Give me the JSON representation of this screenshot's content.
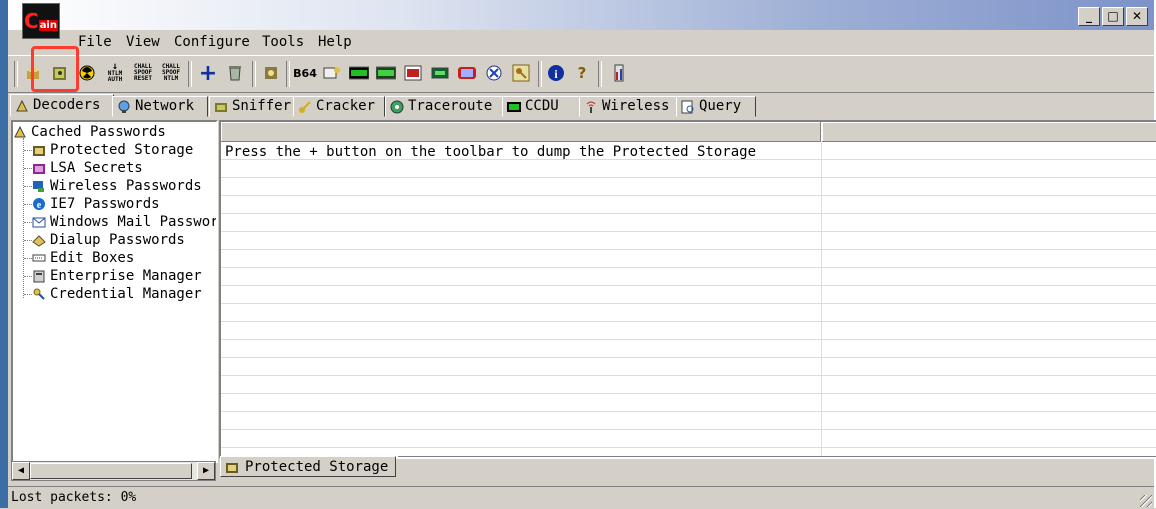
{
  "app": {
    "logo_text_c": "C",
    "logo_text_ain": "ain"
  },
  "window_buttons": {
    "minimize": "_",
    "maximize": "□",
    "close": "✕"
  },
  "menu": [
    {
      "label": "File"
    },
    {
      "label": "View"
    },
    {
      "label": "Configure"
    },
    {
      "label": "Tools"
    },
    {
      "label": "Help"
    }
  ],
  "toolbar": {
    "ntlm_auth": "NTLM AUTH",
    "chall_spoof_reset": "CHALL SPOOF RESET",
    "chall_spoof_ntlm": "CHALL SPOOF NTLM",
    "b64": "B64",
    "highlighted_button": "protected-storage-tool"
  },
  "tabs": [
    {
      "label": "Decoders",
      "active": true
    },
    {
      "label": "Network"
    },
    {
      "label": "Sniffer"
    },
    {
      "label": "Cracker"
    },
    {
      "label": "Traceroute"
    },
    {
      "label": "CCDU"
    },
    {
      "label": "Wireless"
    },
    {
      "label": "Query"
    }
  ],
  "tree": {
    "root": "Cached Passwords",
    "items": [
      {
        "label": "Protected Storage"
      },
      {
        "label": "LSA Secrets"
      },
      {
        "label": "Wireless Passwords"
      },
      {
        "label": "IE7 Passwords"
      },
      {
        "label": "Windows Mail Passwor"
      },
      {
        "label": "Dialup Passwords"
      },
      {
        "label": "Edit Boxes"
      },
      {
        "label": "Enterprise Manager"
      },
      {
        "label": "Credential Manager"
      }
    ]
  },
  "grid": {
    "message": "Press the + button on the toolbar to dump the Protected Storage"
  },
  "subtab": {
    "label": "Protected Storage"
  },
  "status": {
    "text": "Lost packets:  0%"
  },
  "colors": {
    "highlight": "#ff3b30",
    "face": "#d4d0c8",
    "title_gradient_end": "#7d93c9"
  }
}
